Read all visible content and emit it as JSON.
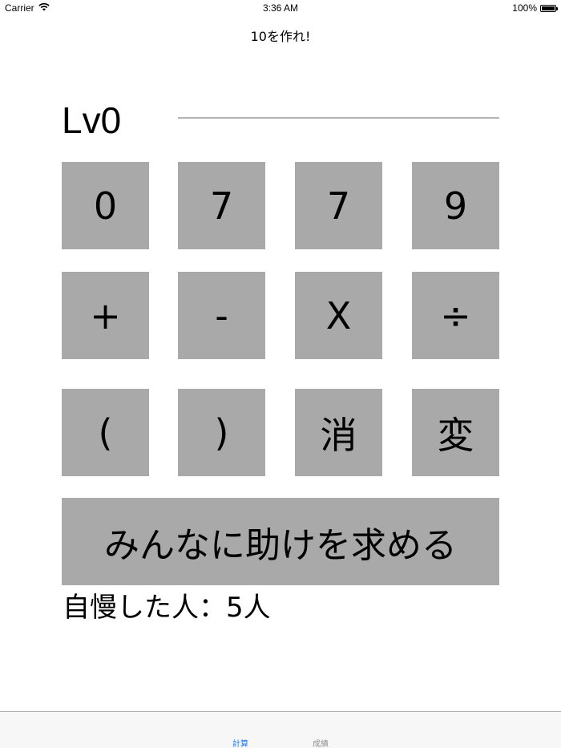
{
  "status_bar": {
    "carrier": "Carrier",
    "time": "3:36 AM",
    "battery_percent": "100%",
    "battery_level": 1.0
  },
  "nav": {
    "title": "10を作れ!"
  },
  "game": {
    "level": "Lv0",
    "answer_value": ""
  },
  "keypad": {
    "digits": [
      "0",
      "7",
      "7",
      "9"
    ],
    "operators": [
      "+",
      "-",
      "X",
      "÷"
    ],
    "controls": [
      "(",
      ")",
      "消",
      "変"
    ]
  },
  "help": {
    "label": "みんなに助けを求める"
  },
  "stats": {
    "brag_label": "自慢した人：",
    "brag_count": "5人"
  },
  "tab_bar": {
    "tabs": [
      {
        "label": "計算",
        "selected": true
      },
      {
        "label": "成績",
        "selected": false
      }
    ],
    "accent_color": "#1a7ee6",
    "inactive_color": "#929292"
  },
  "colors": {
    "key_background": "#a9a9a9",
    "answer_line": "#b3b3b3"
  }
}
